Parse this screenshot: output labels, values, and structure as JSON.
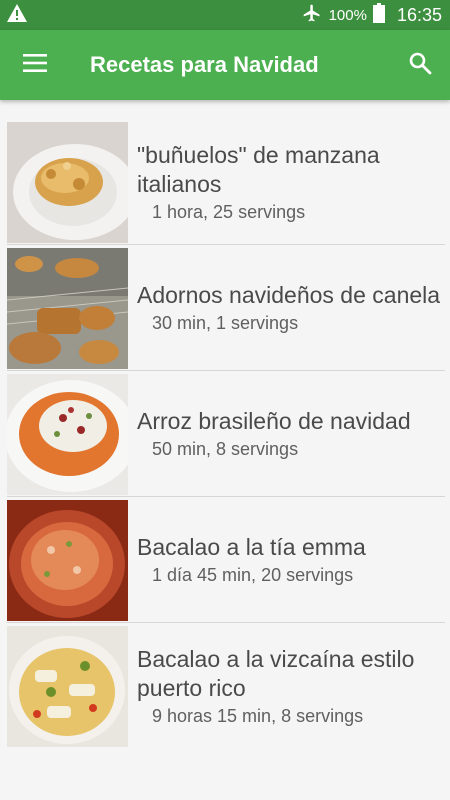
{
  "status_bar": {
    "battery_percent": "100%",
    "time": "16:35",
    "icons": [
      "warning-icon",
      "airplane-icon",
      "battery-icon"
    ]
  },
  "app_bar": {
    "title": "Recetas para Navidad",
    "icons": [
      "menu-icon",
      "search-icon"
    ],
    "color": "#4caf50"
  },
  "recipes": [
    {
      "name": "\"buñuelos\" de manzana italianos",
      "meta": "1 hora, 25 servings"
    },
    {
      "name": "Adornos navideños de canela",
      "meta": "30 min, 1 servings"
    },
    {
      "name": "Arroz brasileño de navidad",
      "meta": "50 min, 8 servings"
    },
    {
      "name": "Bacalao a la tía emma",
      "meta": "1 día 45 min, 20 servings"
    },
    {
      "name": "Bacalao a la vizcaína estilo puerto rico",
      "meta": "9 horas 15 min, 8 servings"
    }
  ]
}
